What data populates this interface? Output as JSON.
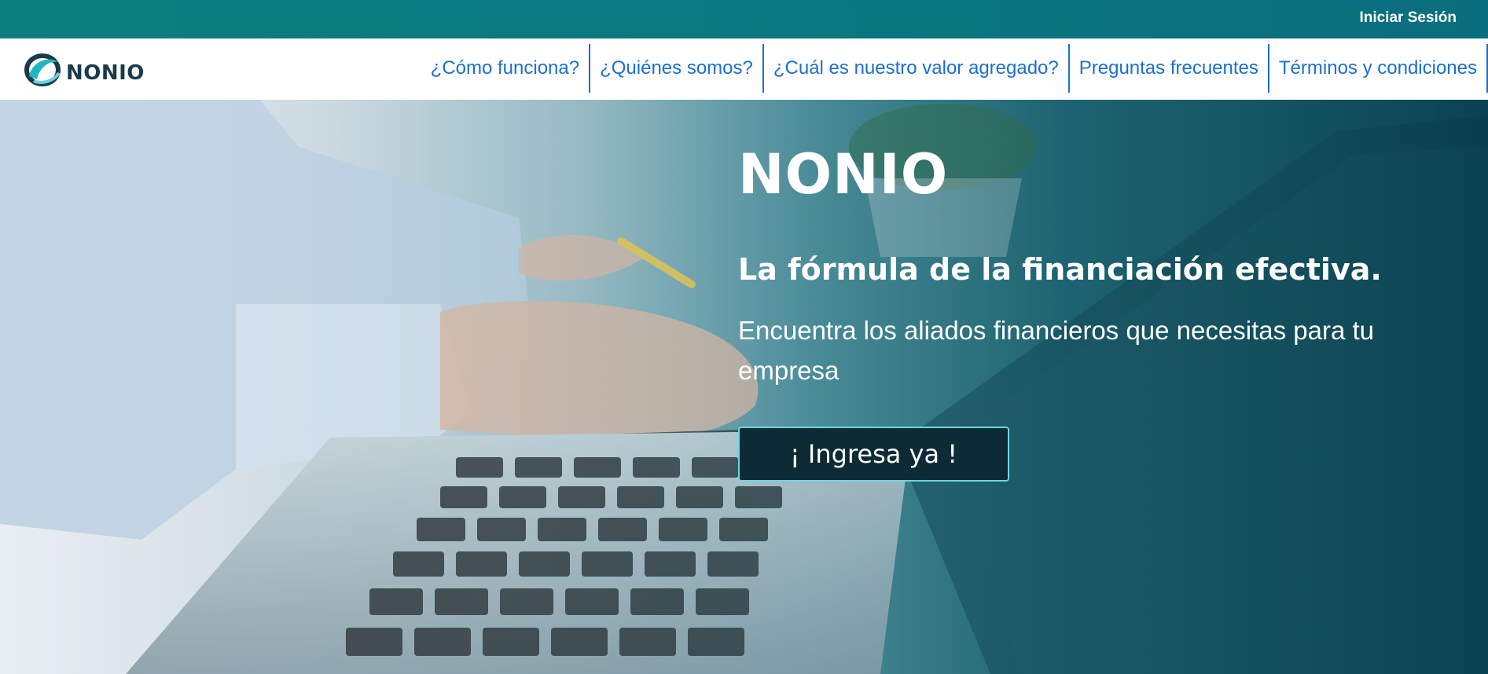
{
  "topbar": {
    "login_label": "Iniciar Sesión"
  },
  "brand": {
    "name": "NONIO",
    "logo_icon": "nonio-logo-icon"
  },
  "nav": {
    "items": [
      {
        "label": "¿Cómo funciona?"
      },
      {
        "label": "¿Quiénes somos?"
      },
      {
        "label": "¿Cuál es nuestro valor agregado?"
      },
      {
        "label": "Preguntas frecuentes"
      },
      {
        "label": "Términos y condiciones"
      }
    ]
  },
  "hero": {
    "title": "NONIO",
    "subtitle": "La fórmula de la financiación efectiva.",
    "description": "Encuentra los aliados financieros que necesitas para tu empresa",
    "cta_label": "¡ Ingresa ya !"
  },
  "colors": {
    "topbar": "#0b7f80",
    "nav_link": "#1b6fcf",
    "cta_background": "#0c2b35",
    "cta_border": "#6fd3e3"
  }
}
